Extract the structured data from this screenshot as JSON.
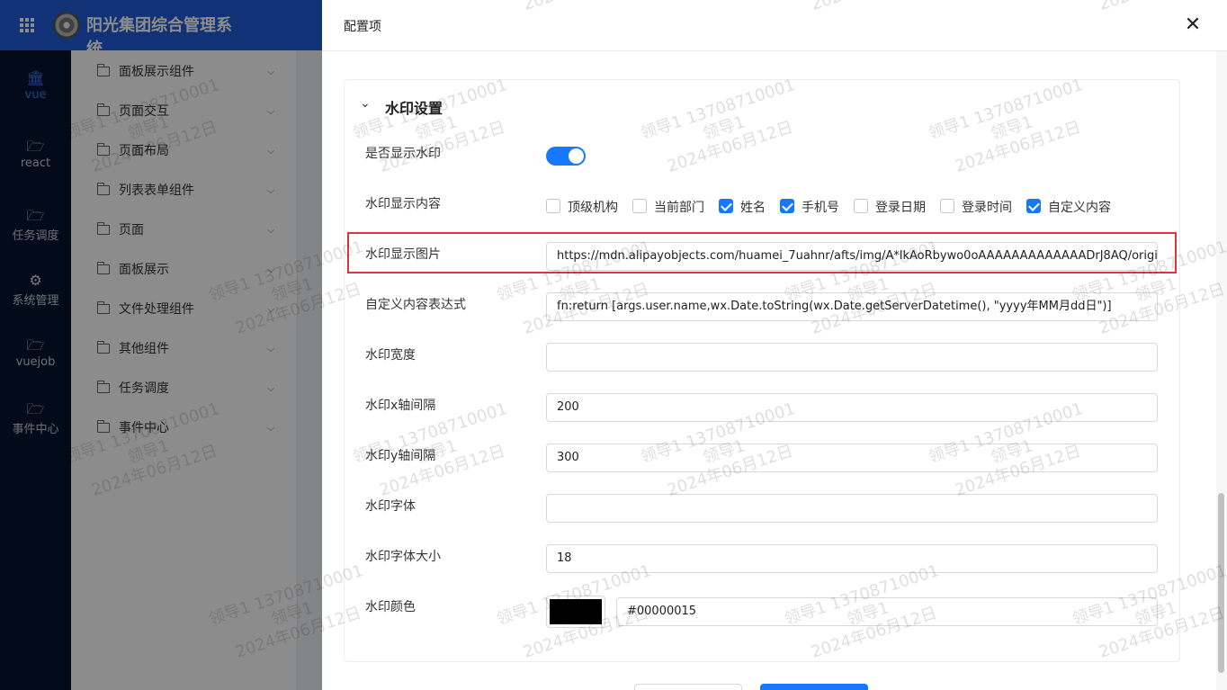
{
  "app": {
    "title": "阳光集团综合管理系统"
  },
  "left_nav": [
    {
      "label": "vue",
      "icon": "bank-icon",
      "active": true
    },
    {
      "label": "react",
      "icon": "folder-icon",
      "active": false
    },
    {
      "label": "任务调度",
      "icon": "folder-icon",
      "active": false
    },
    {
      "label": "系统管理",
      "icon": "gear-icon",
      "active": false
    },
    {
      "label": "vuejob",
      "icon": "folder-icon",
      "active": false
    },
    {
      "label": "事件中心",
      "icon": "folder-icon",
      "active": false
    }
  ],
  "submenu": [
    {
      "label": "面板展示组件"
    },
    {
      "label": "页面交互"
    },
    {
      "label": "页面布局"
    },
    {
      "label": "列表表单组件"
    },
    {
      "label": "页面"
    },
    {
      "label": "面板展示"
    },
    {
      "label": "文件处理组件"
    },
    {
      "label": "其他组件"
    },
    {
      "label": "任务调度"
    },
    {
      "label": "事件中心"
    }
  ],
  "drawer": {
    "title": "配置项",
    "section_title": "水印设置",
    "fields": {
      "show_watermark": {
        "label": "是否显示水印",
        "enabled": true
      },
      "content": {
        "label": "水印显示内容",
        "options": [
          {
            "label": "顶级机构",
            "checked": false
          },
          {
            "label": "当前部门",
            "checked": false
          },
          {
            "label": "姓名",
            "checked": true
          },
          {
            "label": "手机号",
            "checked": true
          },
          {
            "label": "登录日期",
            "checked": false
          },
          {
            "label": "登录时间",
            "checked": false
          },
          {
            "label": "自定义内容",
            "checked": true
          }
        ]
      },
      "image": {
        "label": "水印显示图片",
        "value": "https://mdn.alipayobjects.com/huamei_7uahnr/afts/img/A*lkAoRbywo0oAAAAAAAAAAAAADrJ8AQ/original"
      },
      "expression": {
        "label": "自定义内容表达式",
        "value": "fn:return [args.user.name,wx.Date.toString(wx.Date.getServerDatetime(), \"yyyy年MM月dd日\")]"
      },
      "width": {
        "label": "水印宽度",
        "value": ""
      },
      "x_gap": {
        "label": "水印x轴间隔",
        "value": "200"
      },
      "y_gap": {
        "label": "水印y轴间隔",
        "value": "300"
      },
      "font": {
        "label": "水印字体",
        "value": ""
      },
      "font_size": {
        "label": "水印字体大小",
        "value": "18"
      },
      "color": {
        "label": "水印颜色",
        "value": "#00000015",
        "swatch": "#000000"
      }
    }
  },
  "watermark": {
    "line1": "领导1 13708710001",
    "line2": "领导1",
    "line3": "2024年06月12日"
  },
  "colors": {
    "topbar": "#1f5bd8",
    "nav_bg": "#061430",
    "primary": "#1677ff",
    "highlight_border": "#d9363e"
  }
}
